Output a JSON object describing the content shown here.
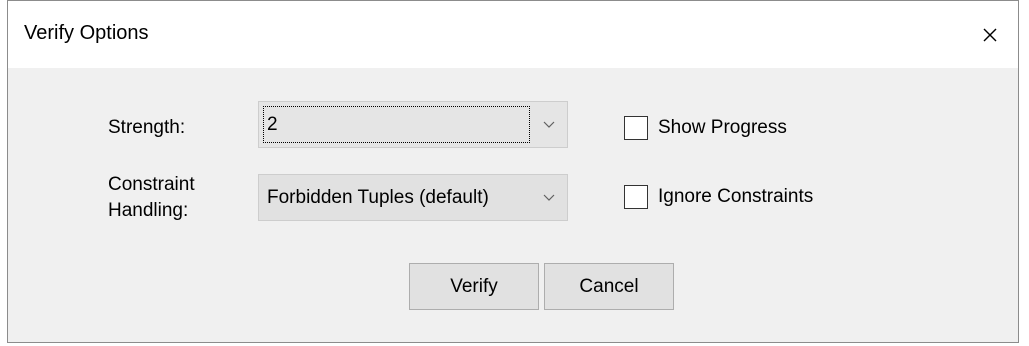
{
  "window": {
    "title": "Verify Options",
    "close_icon": "close-icon"
  },
  "form": {
    "strength": {
      "label": "Strength:",
      "value": "2"
    },
    "constraint_handling": {
      "label_line1": "Constraint",
      "label_line2": "Handling:",
      "value": "Forbidden Tuples (default)"
    },
    "show_progress": {
      "label": "Show Progress",
      "checked": false
    },
    "ignore_constraints": {
      "label": "Ignore Constraints",
      "checked": false
    }
  },
  "buttons": {
    "verify_label": "Verify",
    "cancel_label": "Cancel"
  },
  "colors": {
    "dialog_background": "#f0f0f0",
    "titlebar_background": "#ffffff",
    "control_background": "#e1e1e1"
  }
}
